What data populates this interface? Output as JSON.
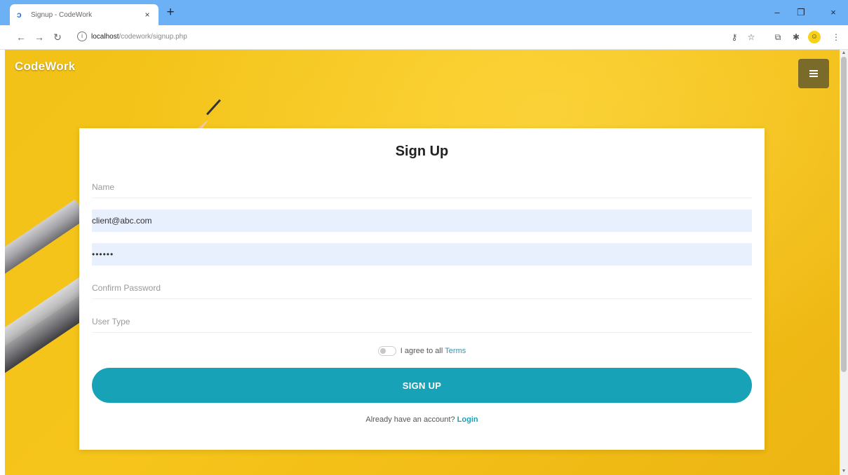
{
  "browser": {
    "tab_title": "Signup - CodeWork",
    "tab_close": "×",
    "new_tab": "+",
    "url_host": "localhost",
    "url_path": "/codework/signup.php",
    "window_controls": {
      "minimize": "–",
      "restore": "❐",
      "close": "×"
    }
  },
  "page": {
    "brand": "CodeWork",
    "form": {
      "title": "Sign Up",
      "name_placeholder": "Name",
      "email_value": "client@abc.com",
      "password_value": "••••••",
      "confirm_placeholder": "Confirm Password",
      "usertype_placeholder": "User Type",
      "agree_text": "I agree to all",
      "terms_link": "Terms",
      "submit_label": "SIGN UP",
      "login_prompt": "Already have an account?",
      "login_link": "Login"
    }
  },
  "colors": {
    "accent": "#17a2b8",
    "background": "#f2c218",
    "menu_button": "#7a6b2b",
    "tab_bar": "#6cb1f5"
  }
}
